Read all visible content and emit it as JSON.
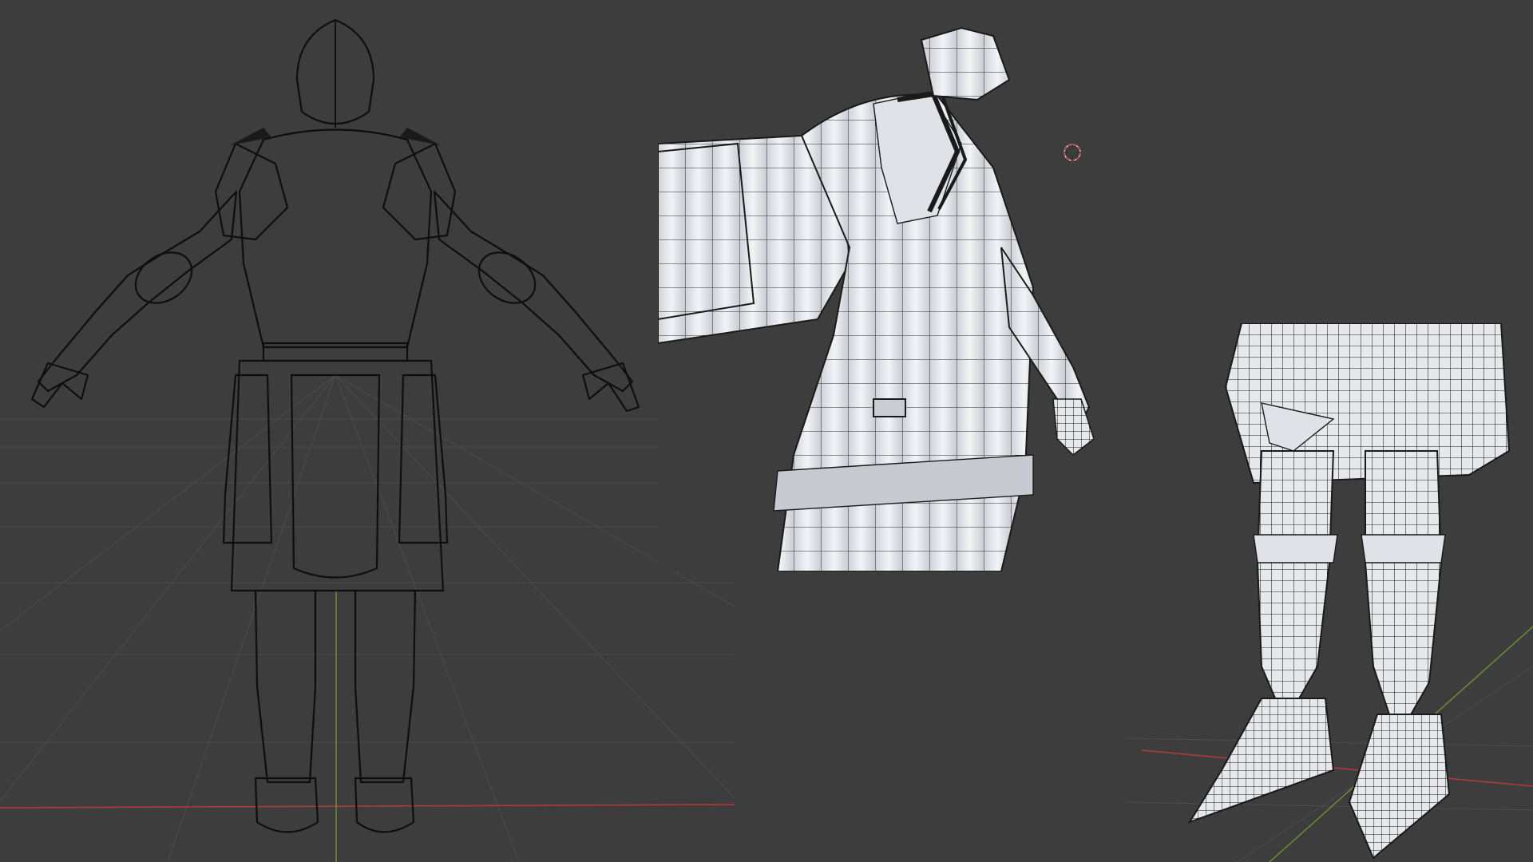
{
  "scene": {
    "background_color": "#3d3d3d",
    "grid_color": "#4a4a4a",
    "x_axis_color": "#b53a3a",
    "y_axis_color": "#6b8f2e",
    "mesh_color": "#e8eaee",
    "wire_color": "#1a1a1a"
  },
  "viewports": [
    {
      "name": "full-body-back-view",
      "content": "knight-armor-mesh"
    },
    {
      "name": "torso-closeup-view",
      "content": "knight-armor-mesh"
    },
    {
      "name": "legs-closeup-view",
      "content": "knight-armor-mesh"
    }
  ],
  "icons": {
    "cursor": "3d-cursor-icon"
  }
}
